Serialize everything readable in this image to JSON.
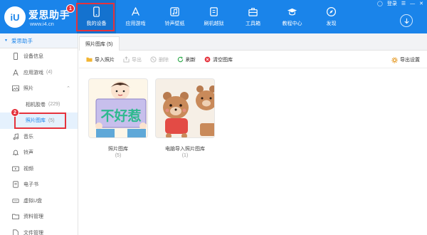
{
  "brand": {
    "name": "爱思助手",
    "url": "www.i4.cn",
    "logo_text": "iU"
  },
  "nav": [
    {
      "label": "我的设备",
      "icon": "phone-icon"
    },
    {
      "label": "应用游戏",
      "icon": "appstore-icon"
    },
    {
      "label": "铃声壁纸",
      "icon": "music-icon"
    },
    {
      "label": "刷机越狱",
      "icon": "box-icon"
    },
    {
      "label": "工具箱",
      "icon": "toolbox-icon"
    },
    {
      "label": "教程中心",
      "icon": "graduation-cap-icon"
    },
    {
      "label": "发现",
      "icon": "compass-icon"
    }
  ],
  "window": {
    "login": "登录"
  },
  "badges": {
    "first": "1",
    "second": "2"
  },
  "sidebar": {
    "device_name": "爱思助手",
    "items": [
      {
        "label": "设备信息",
        "icon": "phone-icon",
        "count": ""
      },
      {
        "label": "应用游戏",
        "icon": "apps-icon",
        "count": "(4)"
      },
      {
        "label": "照片",
        "icon": "photo-icon",
        "count": ""
      },
      {
        "label": "相机胶卷",
        "icon": "",
        "count": "(229)"
      },
      {
        "label": "照片图库",
        "icon": "",
        "count": "(5)"
      },
      {
        "label": "音乐",
        "icon": "music-note-icon",
        "count": ""
      },
      {
        "label": "铃声",
        "icon": "bell-icon",
        "count": ""
      },
      {
        "label": "视频",
        "icon": "video-icon",
        "count": ""
      },
      {
        "label": "电子书",
        "icon": "book-icon",
        "count": ""
      },
      {
        "label": "虚拟U盘",
        "icon": "usb-icon",
        "count": ""
      },
      {
        "label": "资料管理",
        "icon": "folder-icon",
        "count": ""
      },
      {
        "label": "文件管理",
        "icon": "file-icon",
        "count": ""
      }
    ]
  },
  "tab": {
    "label": "照片图库 (5)"
  },
  "toolbar": {
    "import": "导入照片",
    "export": "导出",
    "delete": "删除",
    "refresh": "刷新",
    "clear": "清空图库",
    "export_settings": "导出设置"
  },
  "albums": [
    {
      "name": "照片图库",
      "count": "(5)",
      "thumb_text": "不好惹"
    },
    {
      "name": "电脑导入照片图库",
      "count": "(1)",
      "thumb_text": ""
    }
  ],
  "colors": {
    "header": "#1a84ea",
    "accent_red": "#e5323c",
    "selected_bg": "#e5f1fd"
  }
}
